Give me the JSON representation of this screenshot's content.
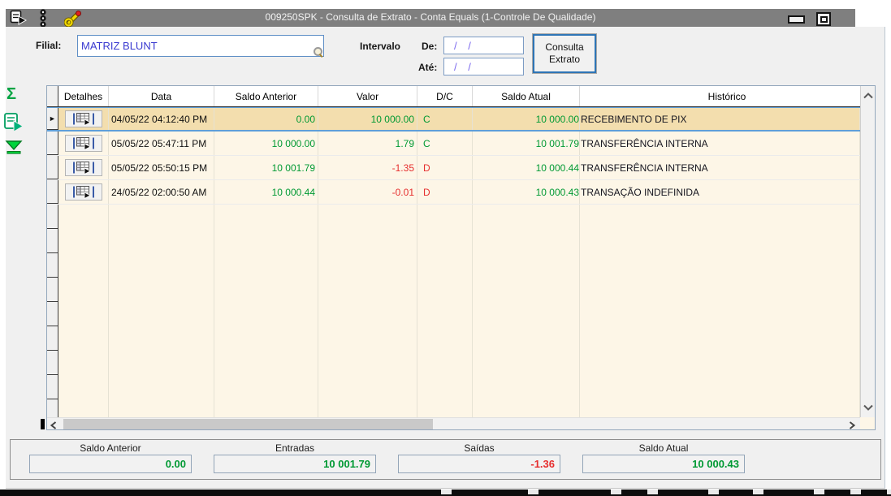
{
  "titlebar": {
    "title": "009250SPK - Consulta de Extrato - Conta Equals (1-Controle De Qualidade)"
  },
  "form": {
    "filial_label": "Filial:",
    "filial_value": "MATRIZ BLUNT",
    "intervalo_label": "Intervalo",
    "de_label": "De:",
    "de_value": "/ /",
    "ate_label": "Até:",
    "ate_value": "/ /",
    "consulta_button_line1": "Consulta",
    "consulta_button_line2": "Extrato"
  },
  "table": {
    "columns": [
      "Detalhes",
      "Data",
      "Saldo Anterior",
      "Valor",
      "D/C",
      "Saldo Atual",
      "Histórico"
    ],
    "rows": [
      {
        "selected": true,
        "data": "04/05/22 04:12:40 PM",
        "saldo_anterior": "0.00",
        "valor": "10 000.00",
        "dc": "C",
        "saldo_atual": "10 000.00",
        "historico": "RECEBIMENTO DE PIX"
      },
      {
        "selected": false,
        "data": "05/05/22 05:47:11 PM",
        "saldo_anterior": "10 000.00",
        "valor": "1.79",
        "dc": "C",
        "saldo_atual": "10 001.79",
        "historico": "TRANSFERÊNCIA INTERNA"
      },
      {
        "selected": false,
        "data": "05/05/22 05:50:15 PM",
        "saldo_anterior": "10 001.79",
        "valor": "-1.35",
        "dc": "D",
        "saldo_atual": "10 000.44",
        "historico": "TRANSFERÊNCIA INTERNA"
      },
      {
        "selected": false,
        "data": "24/05/22 02:00:50 AM",
        "saldo_anterior": "10 000.44",
        "valor": "-0.01",
        "dc": "D",
        "saldo_atual": "10 000.43",
        "historico": "TRANSAÇÃO INDEFINIDA"
      }
    ]
  },
  "summary": {
    "fields": [
      {
        "label": "Saldo Anterior",
        "value": "0.00",
        "color": "green"
      },
      {
        "label": "Entradas",
        "value": "10 001.79",
        "color": "green"
      },
      {
        "label": "Saídas",
        "value": "-1.36",
        "color": "red"
      },
      {
        "label": "Saldo Atual",
        "value": "10 000.43",
        "color": "green"
      }
    ]
  },
  "icons": {
    "sum_glyph": "Σ",
    "current_row_marker": "►"
  },
  "colors": {
    "titlebar_bg": "#7f7f7f",
    "accent_blue": "#2e75b6",
    "input_text_blue": "#3a3ad0",
    "date_mask_blue": "#7b68ee",
    "table_bg": "#fdf6e7",
    "selected_row_bg": "#f3deae",
    "credit_green": "#009933",
    "debit_red": "#e62e2e"
  }
}
